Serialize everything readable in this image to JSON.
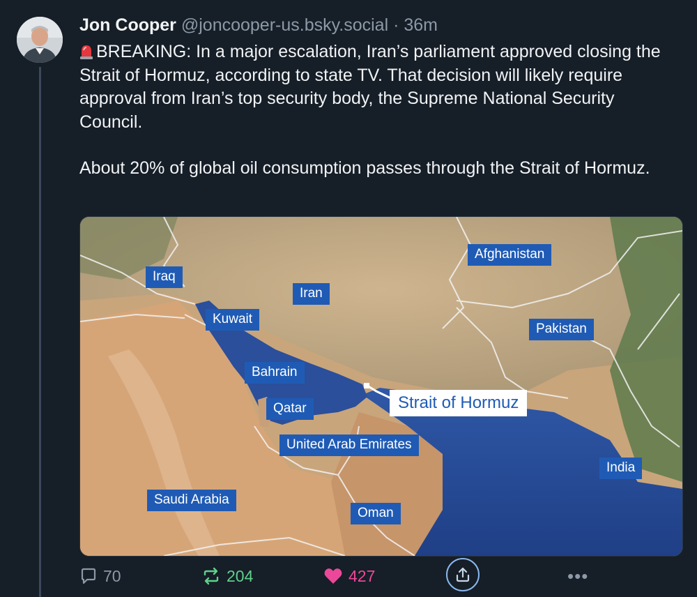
{
  "post": {
    "author_name": "Jon Cooper",
    "handle": "@joncooper-us.bsky.social",
    "separator": "·",
    "time": "36m",
    "paragraph1": "BREAKING: In a major escalation, Iran’s parliament approved closing the Strait of Hormuz, according to state TV. That decision will likely require approval from Iran’s top security body, the Supreme National Security Council.",
    "paragraph2": "About 20% of global oil consumption passes through the Strait of Hormuz."
  },
  "map": {
    "labels": {
      "iraq": "Iraq",
      "iran": "Iran",
      "afghanistan": "Afghanistan",
      "kuwait": "Kuwait",
      "pakistan": "Pakistan",
      "bahrain": "Bahrain",
      "qatar": "Qatar",
      "strait": "Strait of Hormuz",
      "uae": "United Arab Emirates",
      "india": "India",
      "saudi": "Saudi Arabia",
      "oman": "Oman"
    },
    "colors": {
      "sea": "#2a4e96",
      "desert": "#d6a577",
      "mountains": "#b9a78a",
      "vegetation": "#5e7a4c",
      "label_bg": "#1f5bb5"
    }
  },
  "actions": {
    "replies": "70",
    "reposts": "204",
    "likes": "427",
    "more": "•••"
  },
  "icons": [
    "siren-emoji-icon",
    "reply-icon",
    "repost-icon",
    "heart-icon",
    "share-icon",
    "more-icon"
  ]
}
